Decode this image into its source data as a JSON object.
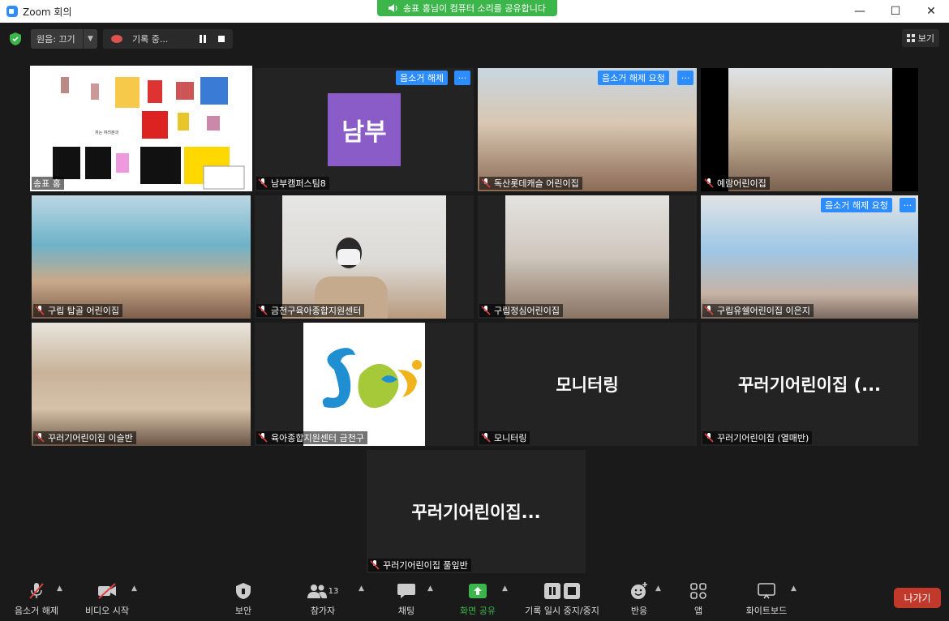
{
  "window": {
    "title": "Zoom 회의",
    "minimize": "—",
    "maximize": "☐",
    "close": "✕"
  },
  "share_banner": "송표 홍님이 컴퓨터 소리를 공유합니다",
  "top_controls": {
    "original_sound": "원음: 끄기",
    "recording": "기록 중...",
    "view": "보기"
  },
  "tiles": [
    {
      "name": "송표 홍",
      "type": "share"
    },
    {
      "name": "남부캠퍼스팀8",
      "avatar_text": "남부",
      "unmute": "음소거 해제",
      "more": "···"
    },
    {
      "name": "독산롯데캐슬 어린이집",
      "unmute": "음소거 해제 요청",
      "more": "···"
    },
    {
      "name": "예람어린이집"
    },
    {
      "name": "구립 탑골 어린이집"
    },
    {
      "name": "금천구육아종합지원센터"
    },
    {
      "name": "구립정심어린이집"
    },
    {
      "name": "구립유쉘어린이집 이은지",
      "unmute": "음소거 해제 요청",
      "more": "···"
    },
    {
      "name": "꾸러기어린이집 이슬반"
    },
    {
      "name": "육아종합지원센터 금천구"
    },
    {
      "name": "모니터링",
      "big": "모니터링"
    },
    {
      "name": "꾸러기어린이집 (열매반)",
      "big": "꾸러기어린이집 (..."
    },
    {
      "name": "꾸러기어린이집 풀잎반",
      "big": "꾸러기어린이집..."
    }
  ],
  "toolbar": {
    "mute": "음소거 해제",
    "video": "비디오 시작",
    "security": "보안",
    "participants": "참가자",
    "participants_count": "13",
    "chat": "채팅",
    "share": "화면 공유",
    "recording_ctrl": "기록 일시 중지/중지",
    "reactions": "반응",
    "apps": "앱",
    "whiteboard": "화이트보드",
    "leave": "나가기"
  },
  "colors": {
    "accent": "#2d8cff",
    "share_green": "#3cb54a",
    "leave_red": "#c0392b",
    "mute_red": "#e04040",
    "speaker": "#b5e54a",
    "avatar_purple": "#8a5cc8"
  }
}
